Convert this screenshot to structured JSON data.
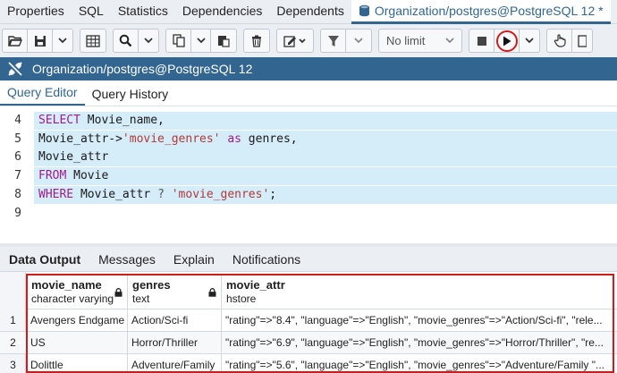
{
  "top_tabs": [
    {
      "label": "Properties"
    },
    {
      "label": "SQL"
    },
    {
      "label": "Statistics"
    },
    {
      "label": "Dependencies"
    },
    {
      "label": "Dependents"
    },
    {
      "label": "Organization/postgres@PostgreSQL 12 *",
      "icon": "database-icon"
    }
  ],
  "toolbar": {
    "limit_label": "No limit"
  },
  "connection": {
    "title": "Organization/postgres@PostgreSQL 12"
  },
  "editor_tabs": [
    {
      "label": "Query Editor"
    },
    {
      "label": "Query History"
    }
  ],
  "editor": {
    "lines": [
      {
        "num": "4",
        "tokens": [
          {
            "t": "SELECT",
            "k": "kw"
          },
          {
            "t": " Movie_name,",
            "k": "tx"
          }
        ]
      },
      {
        "num": "5",
        "tokens": [
          {
            "t": "Movie_attr->",
            "k": "tx"
          },
          {
            "t": "'movie_genres'",
            "k": "str"
          },
          {
            "t": " ",
            "k": "tx"
          },
          {
            "t": "as",
            "k": "kw"
          },
          {
            "t": " genres,",
            "k": "tx"
          }
        ]
      },
      {
        "num": "6",
        "tokens": [
          {
            "t": "Movie_attr",
            "k": "tx"
          }
        ]
      },
      {
        "num": "7",
        "tokens": [
          {
            "t": "FROM",
            "k": "kw"
          },
          {
            "t": " Movie",
            "k": "tx"
          }
        ]
      },
      {
        "num": "8",
        "tokens": [
          {
            "t": "WHERE",
            "k": "kw"
          },
          {
            "t": " Movie_attr ",
            "k": "tx"
          },
          {
            "t": "?",
            "k": "op"
          },
          {
            "t": " ",
            "k": "tx"
          },
          {
            "t": "'movie_genres'",
            "k": "str"
          },
          {
            "t": ";",
            "k": "tx"
          }
        ]
      },
      {
        "num": "9",
        "tokens": []
      }
    ]
  },
  "result_tabs": [
    {
      "label": "Data Output"
    },
    {
      "label": "Messages"
    },
    {
      "label": "Explain"
    },
    {
      "label": "Notifications"
    }
  ],
  "grid": {
    "columns": [
      {
        "name": "movie_name",
        "type": "character varying",
        "locked": true
      },
      {
        "name": "genres",
        "type": "text",
        "locked": true
      },
      {
        "name": "movie_attr",
        "type": "hstore",
        "locked": false
      }
    ],
    "rows": [
      {
        "num": "1",
        "cells": [
          "Avengers Endgame",
          "Action/Sci-fi",
          "\"rating\"=>\"8.4\", \"language\"=>\"English\", \"movie_genres\"=>\"Action/Sci-fi\", \"rele..."
        ]
      },
      {
        "num": "2",
        "cells": [
          "US",
          "Horror/Thriller",
          "\"rating\"=>\"6.9\", \"language\"=>\"English\", \"movie_genres\"=>\"Horror/Thriller\", \"re..."
        ]
      },
      {
        "num": "3",
        "cells": [
          "Dolittle",
          "Adventure/Family",
          "\"rating\"=>\"5.6\", \"language\"=>\"English\", \"movie_genres\"=>\"Adventure/Family \"..."
        ]
      }
    ]
  },
  "colors": {
    "accent": "#326690",
    "highlight": "#d11a1a",
    "selection": "#d5ecf9"
  }
}
